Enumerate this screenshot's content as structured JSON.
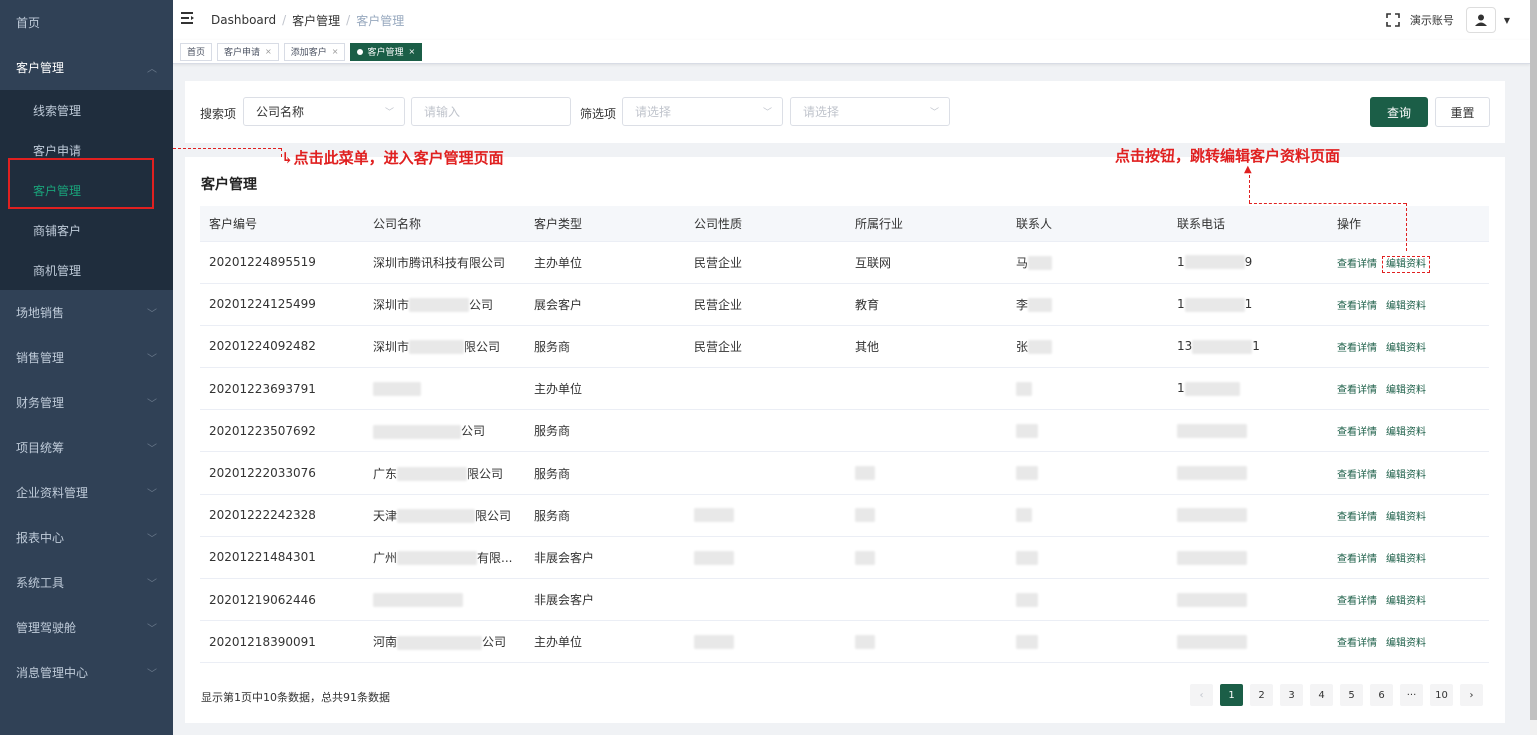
{
  "sidebar": {
    "items": [
      {
        "label": "首页"
      },
      {
        "label": "客户管理",
        "sub": [
          "线索管理",
          "客户申请",
          "客户管理",
          "商铺客户",
          "商机管理"
        ]
      },
      {
        "label": "场地销售"
      },
      {
        "label": "销售管理"
      },
      {
        "label": "财务管理"
      },
      {
        "label": "项目统筹"
      },
      {
        "label": "企业资料管理"
      },
      {
        "label": "报表中心"
      },
      {
        "label": "系统工具"
      },
      {
        "label": "管理驾驶舱"
      },
      {
        "label": "消息管理中心"
      }
    ]
  },
  "header": {
    "breadcrumb": [
      "Dashboard",
      "客户管理",
      "客户管理"
    ],
    "account": "演示账号"
  },
  "tags": [
    "首页",
    "客户申请",
    "添加客户",
    "客户管理"
  ],
  "search": {
    "label": "搜索项",
    "field_value": "公司名称",
    "input_placeholder": "请输入",
    "filter_label": "筛选项",
    "filter1_placeholder": "请选择",
    "filter2_placeholder": "请选择",
    "query_button": "查询",
    "reset_button": "重置"
  },
  "table": {
    "title": "客户管理",
    "headers": [
      "客户编号",
      "公司名称",
      "客户类型",
      "公司性质",
      "所属行业",
      "联系人",
      "联系电话",
      "操作"
    ],
    "rows": [
      {
        "id": "20201224895519",
        "company": "深圳市腾讯科技有限公司",
        "type": "主办单位",
        "nature": "民营企业",
        "industry": "互联网",
        "contact": "马",
        "phone": "1",
        "phone_end": "9"
      },
      {
        "id": "20201224125499",
        "company": "深圳市",
        "company_end": "公司",
        "type": "展会客户",
        "nature": "民营企业",
        "industry": "教育",
        "contact": "李",
        "phone": "1",
        "phone_end": "1"
      },
      {
        "id": "20201224092482",
        "company": "深圳市",
        "company_end": "限公司",
        "type": "服务商",
        "nature": "民营企业",
        "industry": "其他",
        "contact": "张",
        "phone": "13",
        "phone_end": "1"
      },
      {
        "id": "20201223693791",
        "company": "",
        "type": "主办单位",
        "nature": "",
        "industry": "",
        "contact": "",
        "phone": "1",
        "phone_end": ""
      },
      {
        "id": "20201223507692",
        "company": "",
        "company_end": "公司",
        "type": "服务商",
        "nature": "",
        "industry": "",
        "contact": "",
        "phone": "",
        "phone_end": ""
      },
      {
        "id": "20201222033076",
        "company": "广东",
        "company_end": "限公司",
        "type": "服务商",
        "nature": "",
        "industry": "",
        "contact": "",
        "phone": "",
        "phone_end": ""
      },
      {
        "id": "20201222242328",
        "company": "天津",
        "company_end": "限公司",
        "type": "服务商",
        "nature": "",
        "industry": "",
        "contact": "",
        "phone": "",
        "phone_end": ""
      },
      {
        "id": "20201221484301",
        "company": "广州",
        "company_end": "有限...",
        "type": "非展会客户",
        "nature": "",
        "industry": "",
        "contact": "",
        "phone": "",
        "phone_end": ""
      },
      {
        "id": "20201219062446",
        "company": "",
        "company_end": "",
        "type": "非展会客户",
        "nature": "",
        "industry": "",
        "contact": "",
        "phone": "",
        "phone_end": ""
      },
      {
        "id": "20201218390091",
        "company": "河南",
        "company_end": "公司",
        "type": "主办单位",
        "nature": "",
        "industry": "",
        "contact": "",
        "phone": "",
        "phone_end": ""
      }
    ],
    "op_view": "查看详情",
    "op_edit": "编辑资料"
  },
  "footer": {
    "summary": "显示第1页中10条数据，总共91条数据"
  },
  "pager": [
    "1",
    "2",
    "3",
    "4",
    "5",
    "6",
    "···",
    "10"
  ],
  "annotations": {
    "menu_hint": "点击此菜单，进入客户管理页面",
    "button_hint": "点击按钮，跳转编辑客户资料页面"
  },
  "colors": {
    "sidebar_bg": "#304156",
    "primary": "#1b5e47",
    "annotation": "#e02020"
  }
}
